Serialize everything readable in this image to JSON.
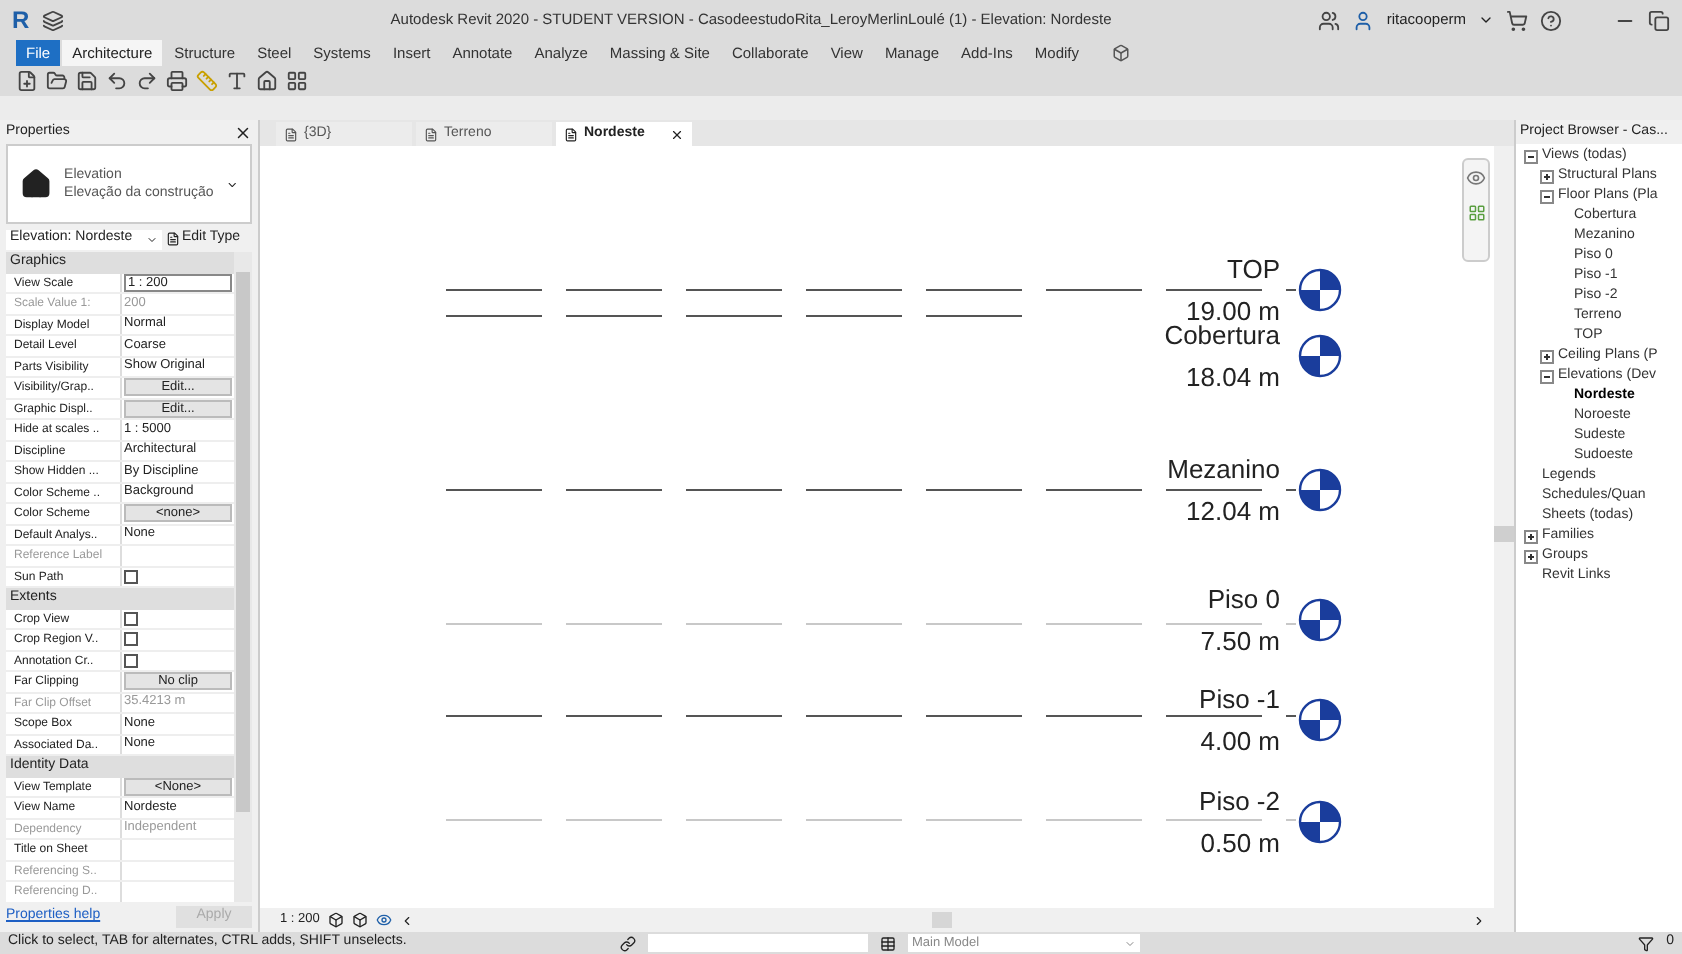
{
  "window": {
    "app_letter": "R",
    "title": "Autodesk Revit 2020 - STUDENT VERSION - CasodeestudoRita_LeroyMerlinLoulé (1) - Elevation: Nordeste",
    "user": "ritacooperm"
  },
  "ribbon_tabs": [
    {
      "label": "File",
      "kind": "file",
      "selected": false
    },
    {
      "label": "Architecture",
      "kind": "tab",
      "selected": true
    },
    {
      "label": "Structure",
      "kind": "tab",
      "selected": false
    },
    {
      "label": "Steel",
      "kind": "tab",
      "selected": false
    },
    {
      "label": "Systems",
      "kind": "tab",
      "selected": false
    },
    {
      "label": "Insert",
      "kind": "tab",
      "selected": false
    },
    {
      "label": "Annotate",
      "kind": "tab",
      "selected": false
    },
    {
      "label": "Analyze",
      "kind": "tab",
      "selected": false
    },
    {
      "label": "Massing & Site",
      "kind": "tab",
      "selected": false
    },
    {
      "label": "Collaborate",
      "kind": "tab",
      "selected": false
    },
    {
      "label": "View",
      "kind": "tab",
      "selected": false
    },
    {
      "label": "Manage",
      "kind": "tab",
      "selected": false
    },
    {
      "label": "Add-Ins",
      "kind": "tab",
      "selected": false
    },
    {
      "label": "Modify",
      "kind": "tab",
      "selected": false
    }
  ],
  "properties": {
    "title": "Properties",
    "type_family": "Elevation",
    "type_name": "Elevação da construção",
    "selector": "Elevation: Nordeste",
    "edit_type": "Edit Type",
    "sections": [
      {
        "title": "Graphics",
        "rows": [
          {
            "label": "View Scale",
            "value": "1 : 200",
            "kind": "field",
            "disabled": false
          },
          {
            "label": "Scale Value    1:",
            "value": "200",
            "kind": "text",
            "disabled": true
          },
          {
            "label": "Display Model",
            "value": "Normal",
            "kind": "text",
            "disabled": false
          },
          {
            "label": "Detail Level",
            "value": "Coarse",
            "kind": "text",
            "disabled": false
          },
          {
            "label": "Parts Visibility",
            "value": "Show Original",
            "kind": "text",
            "disabled": false
          },
          {
            "label": "Visibility/Grap..",
            "value": "Edit...",
            "kind": "button",
            "disabled": false
          },
          {
            "label": "Graphic Displ..",
            "value": "Edit...",
            "kind": "button",
            "disabled": false
          },
          {
            "label": "Hide at scales ..",
            "value": "1 : 5000",
            "kind": "text",
            "disabled": false
          },
          {
            "label": "Discipline",
            "value": "Architectural",
            "kind": "text",
            "disabled": false
          },
          {
            "label": "Show Hidden ...",
            "value": "By Discipline",
            "kind": "text",
            "disabled": false
          },
          {
            "label": "Color Scheme ..",
            "value": "Background",
            "kind": "text",
            "disabled": false
          },
          {
            "label": "Color Scheme",
            "value": "<none>",
            "kind": "button",
            "disabled": false
          },
          {
            "label": "Default Analys..",
            "value": "None",
            "kind": "text",
            "disabled": false
          },
          {
            "label": "Reference Label",
            "kind": "text",
            "disabled": true
          },
          {
            "label": "Sun Path",
            "kind": "checkbox",
            "checked": false,
            "disabled": false
          }
        ]
      },
      {
        "title": "Extents",
        "rows": [
          {
            "label": "Crop View",
            "kind": "checkbox",
            "checked": false,
            "disabled": false
          },
          {
            "label": "Crop Region V..",
            "kind": "checkbox",
            "checked": false,
            "disabled": false
          },
          {
            "label": "Annotation Cr..",
            "kind": "checkbox",
            "checked": false,
            "disabled": false
          },
          {
            "label": "Far Clipping",
            "value": "No clip",
            "kind": "button",
            "disabled": false
          },
          {
            "label": "Far Clip Offset",
            "value": "35.4213 m",
            "kind": "text",
            "disabled": true
          },
          {
            "label": "Scope Box",
            "value": "None",
            "kind": "text",
            "disabled": false
          },
          {
            "label": "Associated Da..",
            "value": "None",
            "kind": "text",
            "disabled": false
          }
        ]
      },
      {
        "title": "Identity Data",
        "rows": [
          {
            "label": "View Template",
            "value": "<None>",
            "kind": "button",
            "disabled": false
          },
          {
            "label": "View Name",
            "value": "Nordeste",
            "kind": "text",
            "disabled": false
          },
          {
            "label": "Dependency",
            "value": "Independent",
            "kind": "text",
            "disabled": true
          },
          {
            "label": "Title on Sheet",
            "kind": "text",
            "disabled": false
          },
          {
            "label": "Referencing S..",
            "kind": "text",
            "disabled": true
          },
          {
            "label": "Referencing D..",
            "kind": "text",
            "disabled": true
          }
        ]
      }
    ],
    "help": "Properties help",
    "apply": "Apply"
  },
  "view_tabs": [
    {
      "label": "{3D}",
      "selected": false
    },
    {
      "label": "Terreno",
      "selected": false
    },
    {
      "label": "Nordeste",
      "selected": true
    }
  ],
  "levels": [
    {
      "name": "TOP",
      "elevation": "19.00 m"
    },
    {
      "name": "Cobertura",
      "elevation": "18.04 m"
    },
    {
      "name": "Mezanino",
      "elevation": "12.04 m"
    },
    {
      "name": "Piso 0",
      "elevation": "7.50 m"
    },
    {
      "name": "Piso -1",
      "elevation": "4.00 m"
    },
    {
      "name": "Piso -2",
      "elevation": "0.50 m"
    }
  ],
  "view_scale": "1 : 200",
  "project_browser": {
    "title": "Project Browser - Cas...",
    "tree": [
      {
        "label": "Views (todas)",
        "expanded": true,
        "selected": false,
        "children": [
          {
            "label": "Structural Plans",
            "expanded": false,
            "selected": false
          },
          {
            "label": "Floor Plans (Pla",
            "expanded": true,
            "selected": false,
            "children": [
              {
                "label": "Cobertura",
                "selected": false
              },
              {
                "label": "Mezanino",
                "selected": false
              },
              {
                "label": "Piso 0",
                "selected": false
              },
              {
                "label": "Piso -1",
                "selected": false
              },
              {
                "label": "Piso -2",
                "selected": false
              },
              {
                "label": "Terreno",
                "selected": false
              },
              {
                "label": "TOP",
                "selected": false
              }
            ]
          },
          {
            "label": "Ceiling Plans (P",
            "expanded": false,
            "selected": false
          },
          {
            "label": "Elevations (Dev",
            "expanded": true,
            "selected": false,
            "children": [
              {
                "label": "Nordeste",
                "selected": true
              },
              {
                "label": "Noroeste",
                "selected": false
              },
              {
                "label": "Sudeste",
                "selected": false
              },
              {
                "label": "Sudoeste",
                "selected": false
              }
            ]
          }
        ]
      },
      {
        "label": "Legends",
        "selected": false
      },
      {
        "label": "Schedules/Quan",
        "selected": false
      },
      {
        "label": "Sheets (todas)",
        "selected": false
      },
      {
        "label": "Families",
        "expanded": false,
        "selected": false
      },
      {
        "label": "Groups",
        "expanded": false,
        "selected": false
      },
      {
        "label": "Revit Links",
        "selected": false
      }
    ]
  },
  "status_bar": {
    "message": "Click to select, TAB for alternates, CTRL adds, SHIFT unselects.",
    "model": "Main Model",
    "filter_count": "0"
  }
}
